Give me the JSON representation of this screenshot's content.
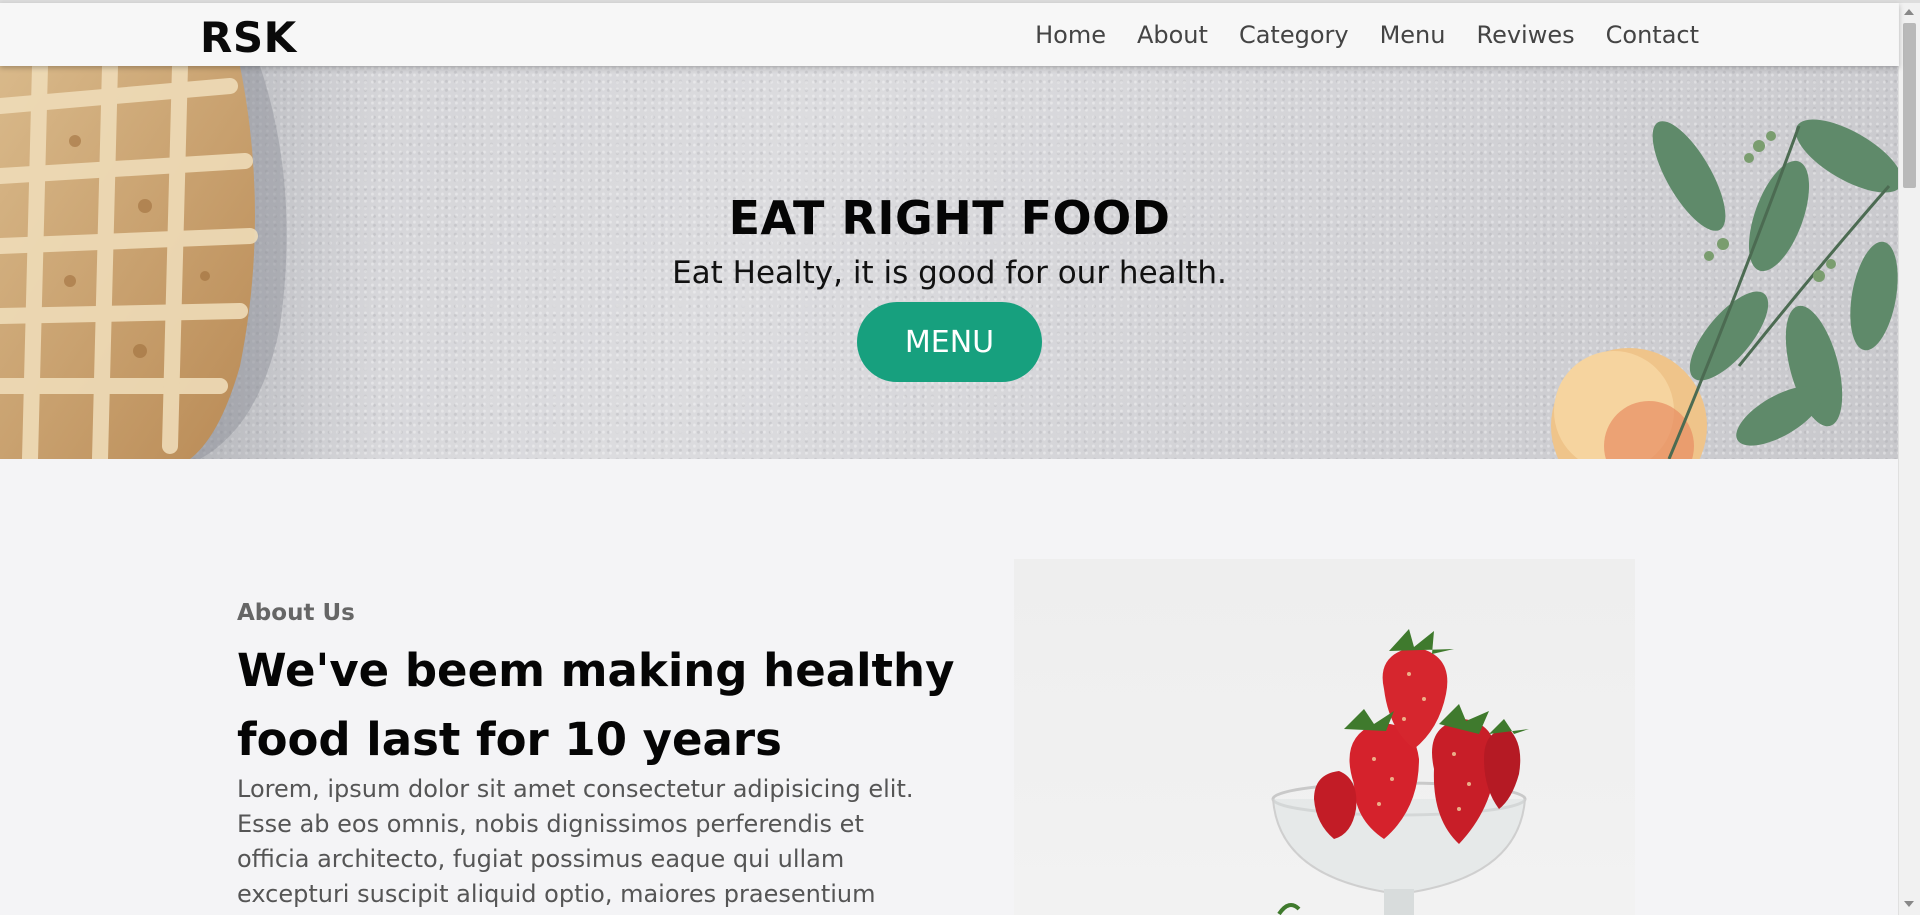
{
  "navbar": {
    "logo": "RSK",
    "links": [
      "Home",
      "About",
      "Category",
      "Menu",
      "Reviwes",
      "Contact"
    ]
  },
  "hero": {
    "title": "EAT RIGHT FOOD",
    "subtitle": "Eat Healty, it is good for our health.",
    "button_label": "MENU"
  },
  "about": {
    "subheading": "About Us",
    "heading": "We've beem making healthy food last for 10 years",
    "text": "Lorem, ipsum dolor sit amet consectetur adipisicing elit. Esse ab eos omnis, nobis dignissimos perferendis et officia architecto, fugiat possimus eaque qui ullam excepturi suscipit aliquid optio, maiores praesentium"
  },
  "colors": {
    "accent": "#17a07e",
    "page_background": "#f4f4f6"
  }
}
